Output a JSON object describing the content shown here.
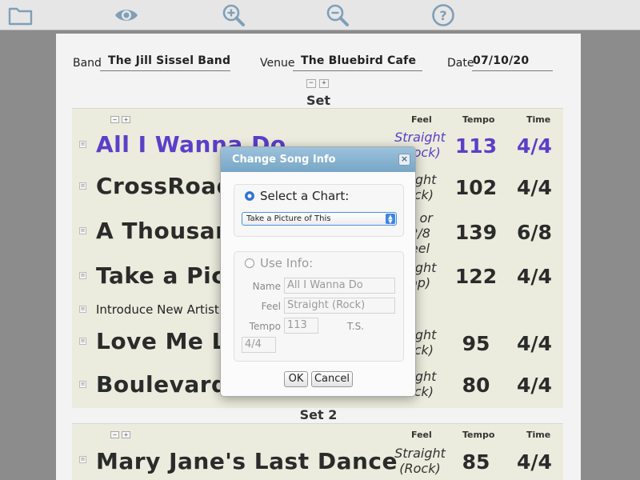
{
  "toolbar": {
    "icons": [
      "folder-icon",
      "eye-icon",
      "zoom-in-icon",
      "zoom-out-icon",
      "help-icon"
    ],
    "icon_color": "#7f9fb8"
  },
  "header": {
    "band_label": "Band",
    "band_value": "The Jill Sissel Band",
    "venue_label": "Venue",
    "venue_value": "The Bluebird Cafe",
    "date_label": "Date",
    "date_value": "07/10/20"
  },
  "sets": [
    {
      "title": "Set",
      "col_feel": "Feel",
      "col_tempo": "Tempo",
      "col_time": "Time",
      "songs": [
        {
          "title": "All I Wanna Do",
          "feel1": "Straight",
          "feel2": "(Rock)",
          "tempo": "113",
          "time": "4/4"
        },
        {
          "title": "CrossRoads",
          "feel1": "aight",
          "feel2": "ock)",
          "tempo": "102",
          "time": "4/4"
        },
        {
          "title": "A Thousand Y",
          "feel1": "8 or",
          "feel2": "2/8",
          "feel3": "eel",
          "tempo": "139",
          "time": "6/8"
        },
        {
          "title": "Take a Pictur",
          "feel1": "aight",
          "feel2": "op)",
          "tempo": "122",
          "time": "4/4"
        },
        {
          "note": "Introduce New Artist S"
        },
        {
          "title": "Love Me Like",
          "feel1": "aight",
          "feel2": "ock)",
          "tempo": "95",
          "time": "4/4"
        },
        {
          "title": "Boulevard of",
          "feel1": "aight",
          "feel2": "ock)",
          "tempo": "80",
          "time": "4/4"
        }
      ]
    },
    {
      "title": "Set 2",
      "col_feel": "Feel",
      "col_tempo": "Tempo",
      "col_time": "Time",
      "songs": [
        {
          "title": "Mary Jane's Last Dance",
          "feel1": "Straight",
          "feel2": "(Rock)",
          "tempo": "85",
          "time": "4/4"
        }
      ]
    }
  ],
  "dialog": {
    "title": "Change Song Info",
    "close_glyph": "×",
    "select_chart_label": "Select a Chart:",
    "chart_selected": "Take a Picture of This",
    "use_info_label": "Use Info:",
    "name_label": "Name",
    "name_value": "All I Wanna Do",
    "feel_label": "Feel",
    "feel_value": "Straight (Rock)",
    "tempo_label": "Tempo",
    "tempo_value": "113",
    "ts_label": "T.S.",
    "ts_value": "4/4",
    "ok_label": "OK",
    "cancel_label": "Cancel"
  },
  "controls": {
    "minus": "−",
    "plus": "+",
    "handle": "≡"
  },
  "colors": {
    "highlight": "#5a3fc8",
    "accent": "#77a6c6"
  }
}
